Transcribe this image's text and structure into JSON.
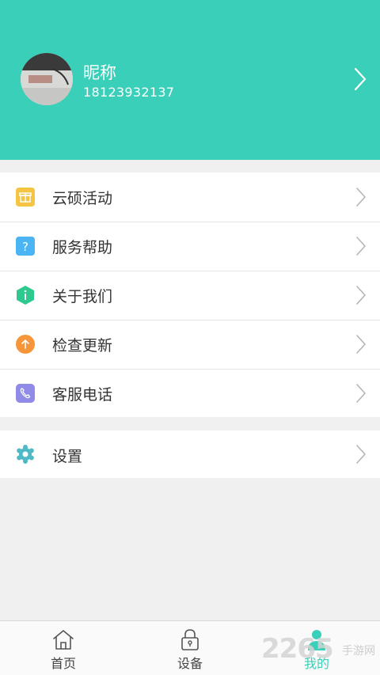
{
  "profile": {
    "nickname": "昵称",
    "phone": "18123932137",
    "chevron_icon": "chevron-right-icon"
  },
  "menu_main": [
    {
      "label": "云硕活动",
      "icon": "gift-icon",
      "color": "#f5c443"
    },
    {
      "label": "服务帮助",
      "icon": "question-icon",
      "color": "#4ab5f2"
    },
    {
      "label": "关于我们",
      "icon": "info-hexagon-icon",
      "color": "#2ec98e"
    },
    {
      "label": "检查更新",
      "icon": "upload-arrow-icon",
      "color": "#f7953a"
    },
    {
      "label": "客服电话",
      "icon": "phone-icon",
      "color": "#8f8be6"
    }
  ],
  "menu_settings": [
    {
      "label": "设置",
      "icon": "gear-icon",
      "color": "#4fb9c6"
    }
  ],
  "tabbar": {
    "tabs": [
      {
        "label": "首页",
        "icon": "home-icon",
        "active": false
      },
      {
        "label": "设备",
        "icon": "lock-icon",
        "active": false
      },
      {
        "label": "我的",
        "icon": "user-icon",
        "active": true
      }
    ]
  },
  "watermark": {
    "number": "2265",
    "text": "手游网"
  },
  "colors": {
    "accent": "#3acfb8",
    "background": "#f0f0f0"
  }
}
